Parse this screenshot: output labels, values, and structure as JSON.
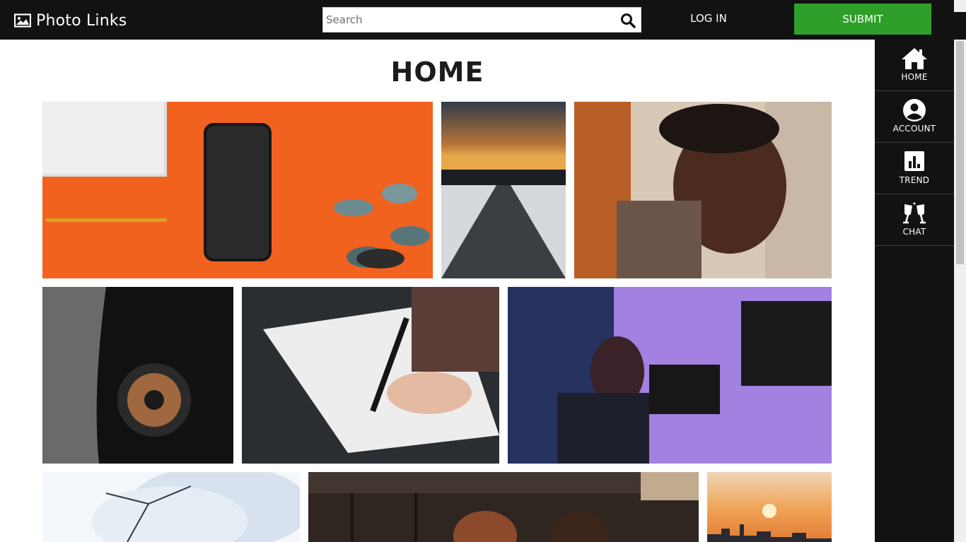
{
  "header": {
    "brand": "Photo Links",
    "search_placeholder": "Search",
    "login_label": "LOG IN",
    "submit_label": "SUBMIT"
  },
  "sidebar": {
    "items": [
      {
        "label": "HOME",
        "icon": "home-icon"
      },
      {
        "label": "ACCOUNT",
        "icon": "account-icon"
      },
      {
        "label": "TREND",
        "icon": "trend-icon"
      },
      {
        "label": "CHAT",
        "icon": "chat-icon"
      }
    ]
  },
  "main": {
    "title": "HOME"
  },
  "colors": {
    "topbar": "#121212",
    "submit": "#2ea02a",
    "sidebar": "#121212"
  }
}
